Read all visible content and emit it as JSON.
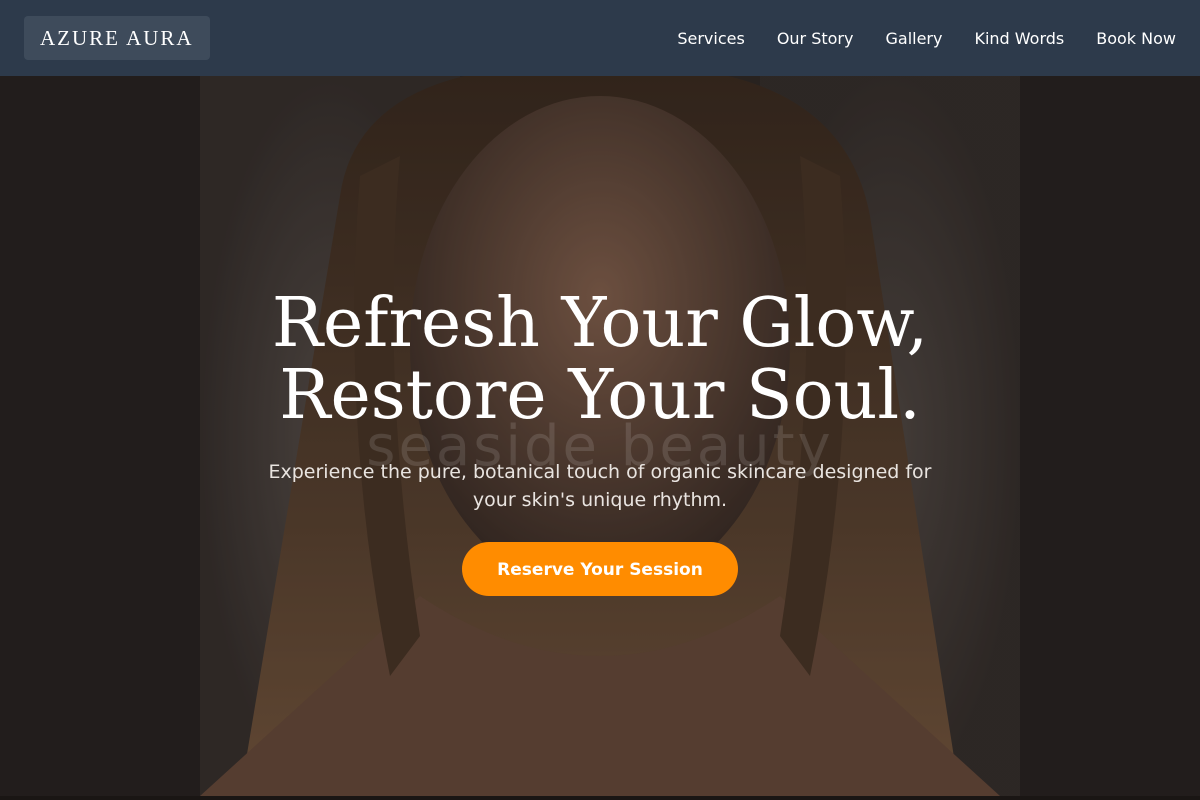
{
  "brand": {
    "name": "AZURE AURA"
  },
  "nav": {
    "items": [
      {
        "label": "Services"
      },
      {
        "label": "Our Story"
      },
      {
        "label": "Gallery"
      },
      {
        "label": "Kind Words"
      },
      {
        "label": "Book Now"
      }
    ]
  },
  "hero": {
    "title_line1": "Refresh Your Glow,",
    "title_line2": "Restore Your Soul.",
    "watermark": "seaside beauty",
    "subtitle": "Experience the pure, botanical touch of organic skincare designed for your skin's unique rhythm.",
    "cta_label": "Reserve Your Session"
  },
  "colors": {
    "navbar": "#2d3a4b",
    "accent": "#ff8c00",
    "text": "#ffffff"
  }
}
